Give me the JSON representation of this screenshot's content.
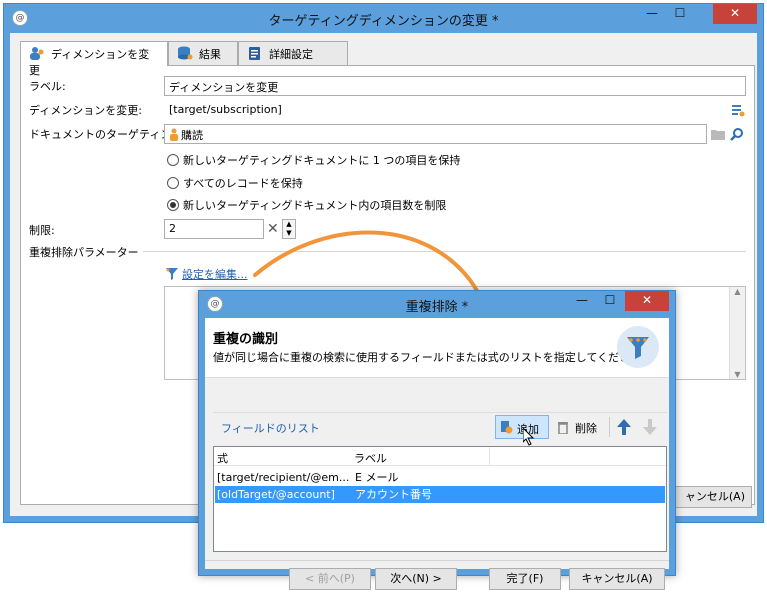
{
  "main": {
    "title": "ターゲティングディメンションの変更 *",
    "tabs": [
      {
        "label": "ディメンションを変更"
      },
      {
        "label": "結果"
      },
      {
        "label": "詳細設定"
      }
    ],
    "fields": {
      "label_caption": "ラベル:",
      "label_value": "ディメンションを変更",
      "dimension_caption": "ディメンションを変更:",
      "dimension_value": "[target/subscription]",
      "targeting_caption": "ドキュメントのターゲティング:",
      "targeting_value": "購読",
      "limit_caption": "制限:",
      "limit_value": "2"
    },
    "radios": [
      {
        "label": "新しいターゲティングドキュメントに 1 つの項目を保持",
        "checked": false
      },
      {
        "label": "すべてのレコードを保持",
        "checked": false
      },
      {
        "label": "新しいターゲティングドキュメント内の項目数を制限",
        "checked": true
      }
    ],
    "dedup_section": "重複排除パラメーター",
    "edit_link": "設定を編集...",
    "cancel_button": "ャンセル(A)"
  },
  "dialog": {
    "title": "重複排除 *",
    "heading": "重複の識別",
    "description": "値が同じ場合に重複の検索に使用するフィールドまたは式のリストを指定してくださ",
    "list_title": "フィールドのリスト",
    "add_button": "追加",
    "delete_button": "削除",
    "columns": [
      "式",
      "ラベル"
    ],
    "rows": [
      {
        "expr": "[target/recipient/@em...",
        "label": "E メール",
        "selected": false
      },
      {
        "expr": "[oldTarget/@account]",
        "label": "アカウント番号",
        "selected": true
      }
    ],
    "buttons": {
      "prev": "< 前へ(P)",
      "next": "次へ(N) >",
      "finish": "完了(F)",
      "cancel": "キャンセル(A)"
    }
  },
  "colors": {
    "titlebar": "#5ba0dd",
    "close": "#c7433a",
    "selection": "#3399ff",
    "arrow": "#f0953a",
    "link": "#1d5fb3"
  }
}
